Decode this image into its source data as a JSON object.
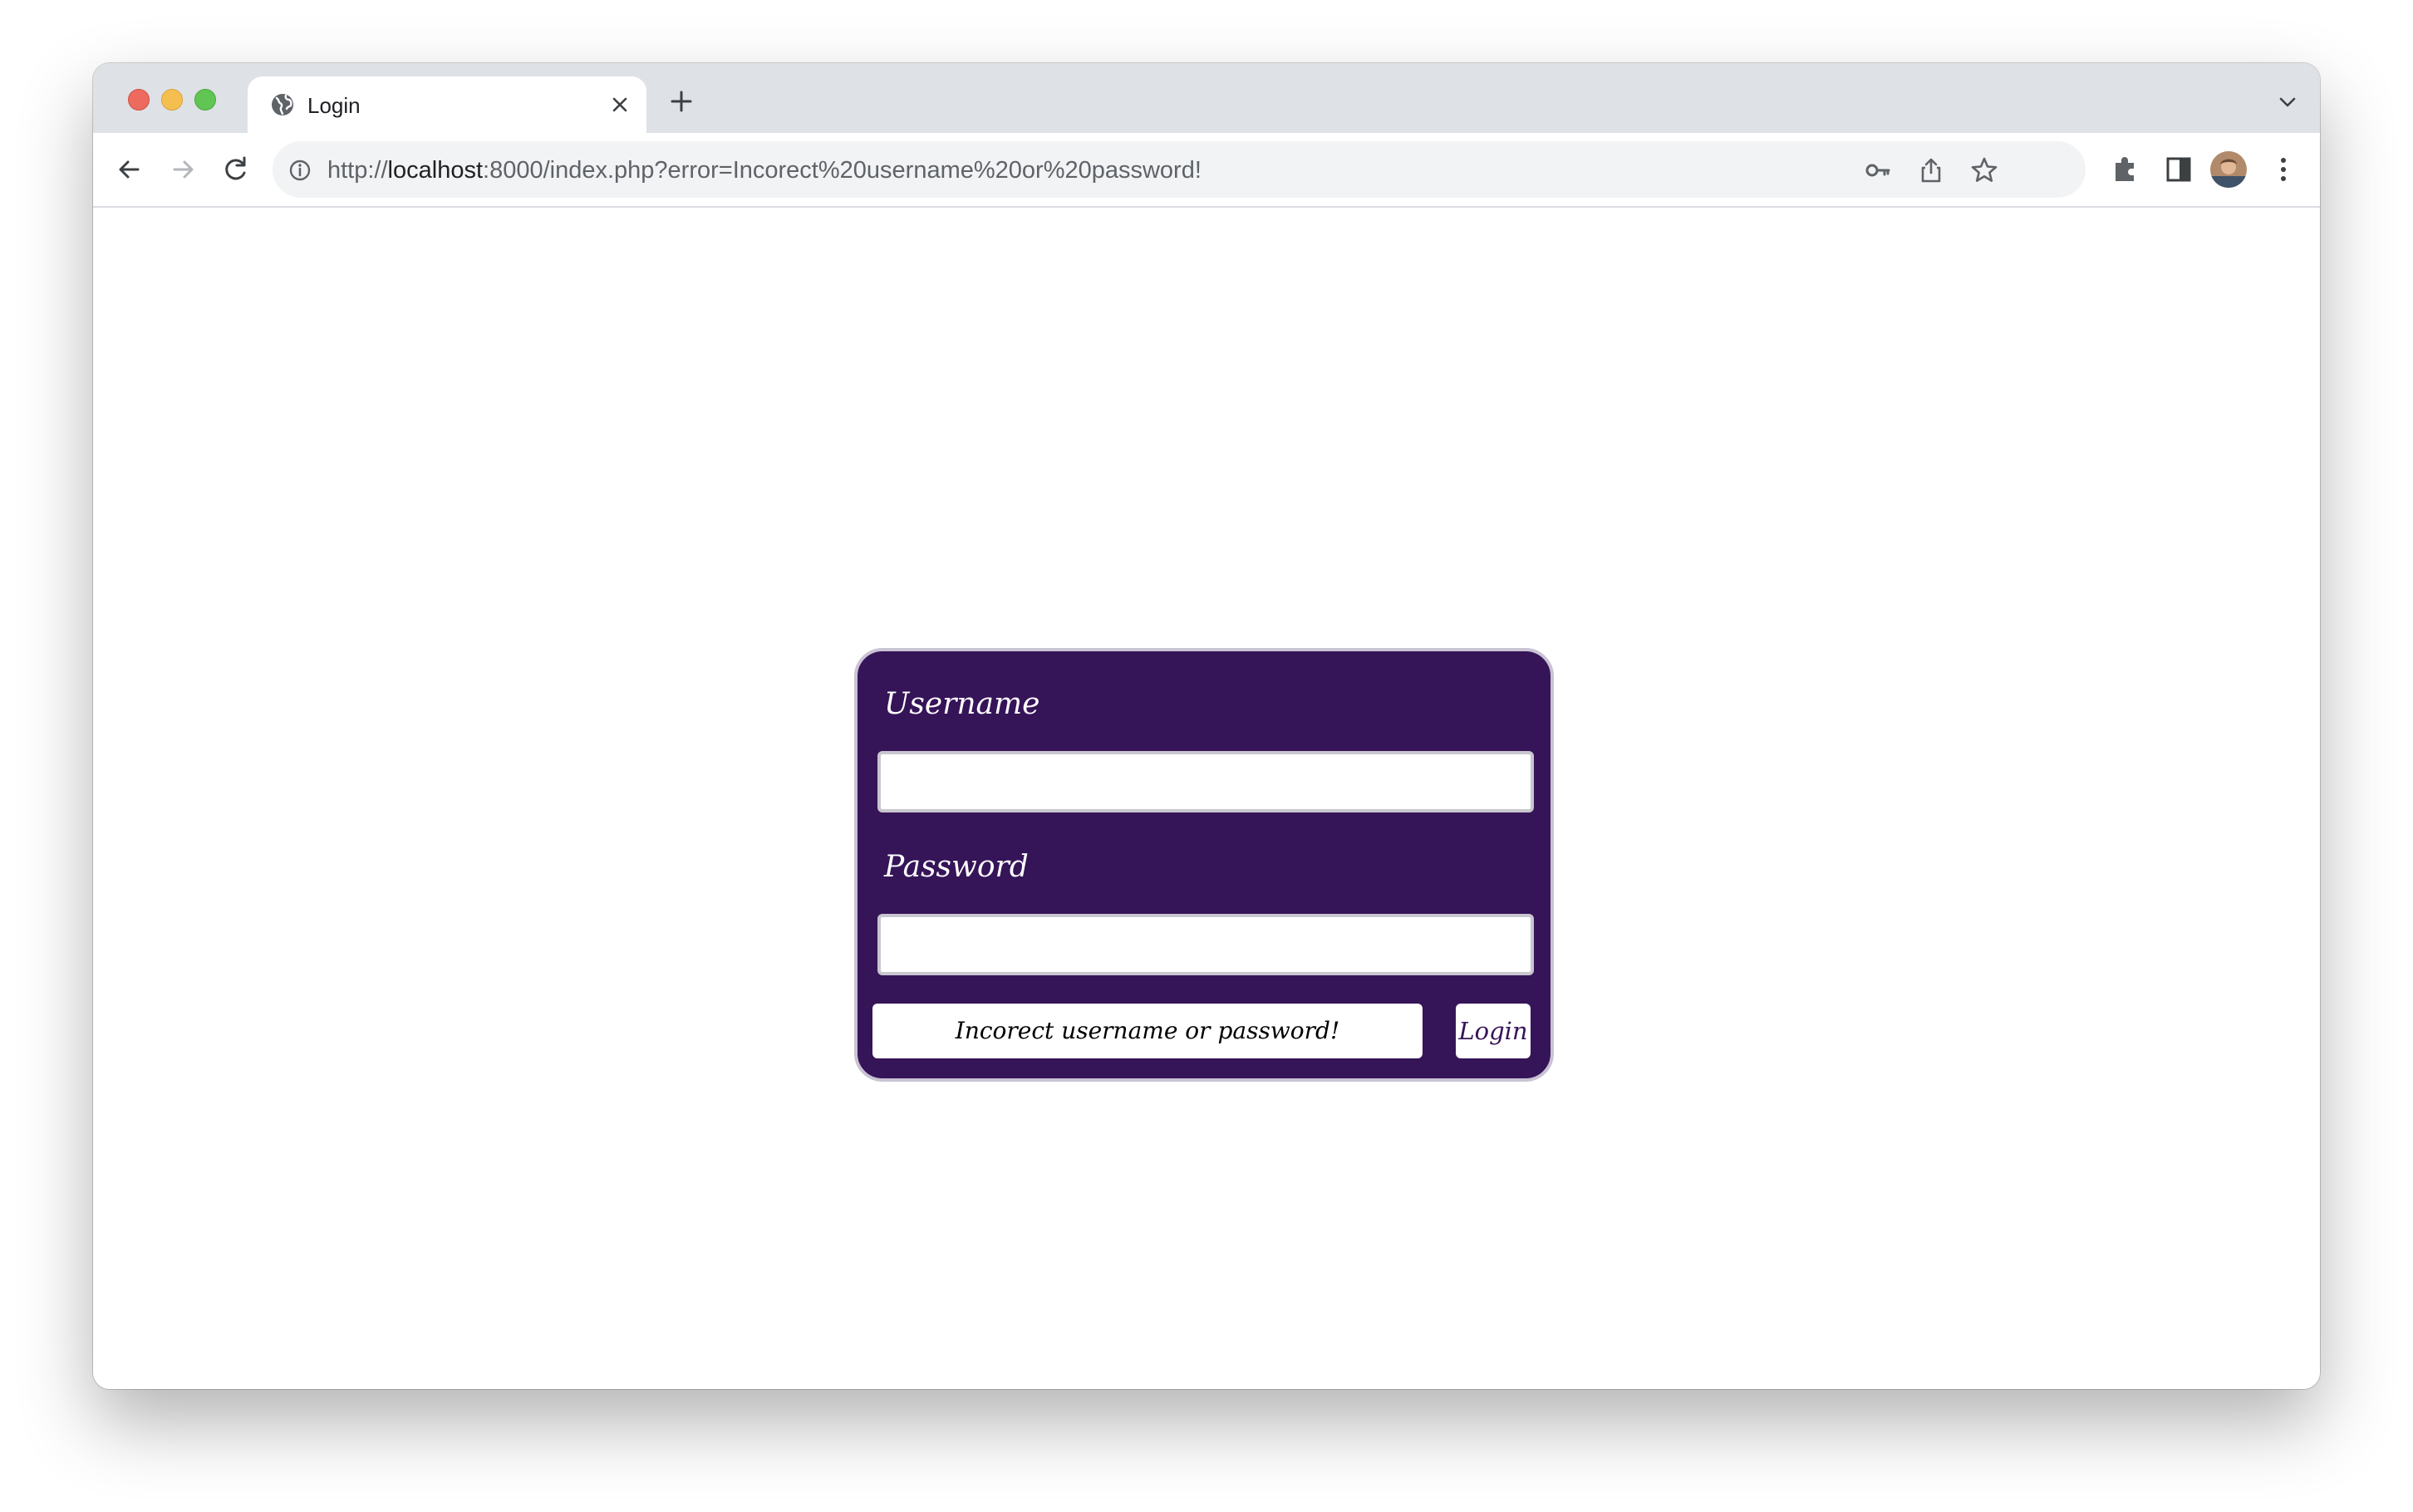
{
  "tab": {
    "title": "Login",
    "icon": "globe-icon"
  },
  "address_bar": {
    "url_scheme": "http://",
    "url_host": "localhost",
    "url_rest": ":8000/index.php?error=Incorect%20username%20or%20password!"
  },
  "form": {
    "username_label": "Username",
    "password_label": "Password",
    "username_value": "",
    "password_value": "",
    "error_message": "Incorect username or password!",
    "login_button": "Login"
  },
  "colors": {
    "card_background": "#361458",
    "card_border": "#c9c3d4",
    "tab_bar": "#dee1e6",
    "omnibox": "#f1f3f4"
  }
}
